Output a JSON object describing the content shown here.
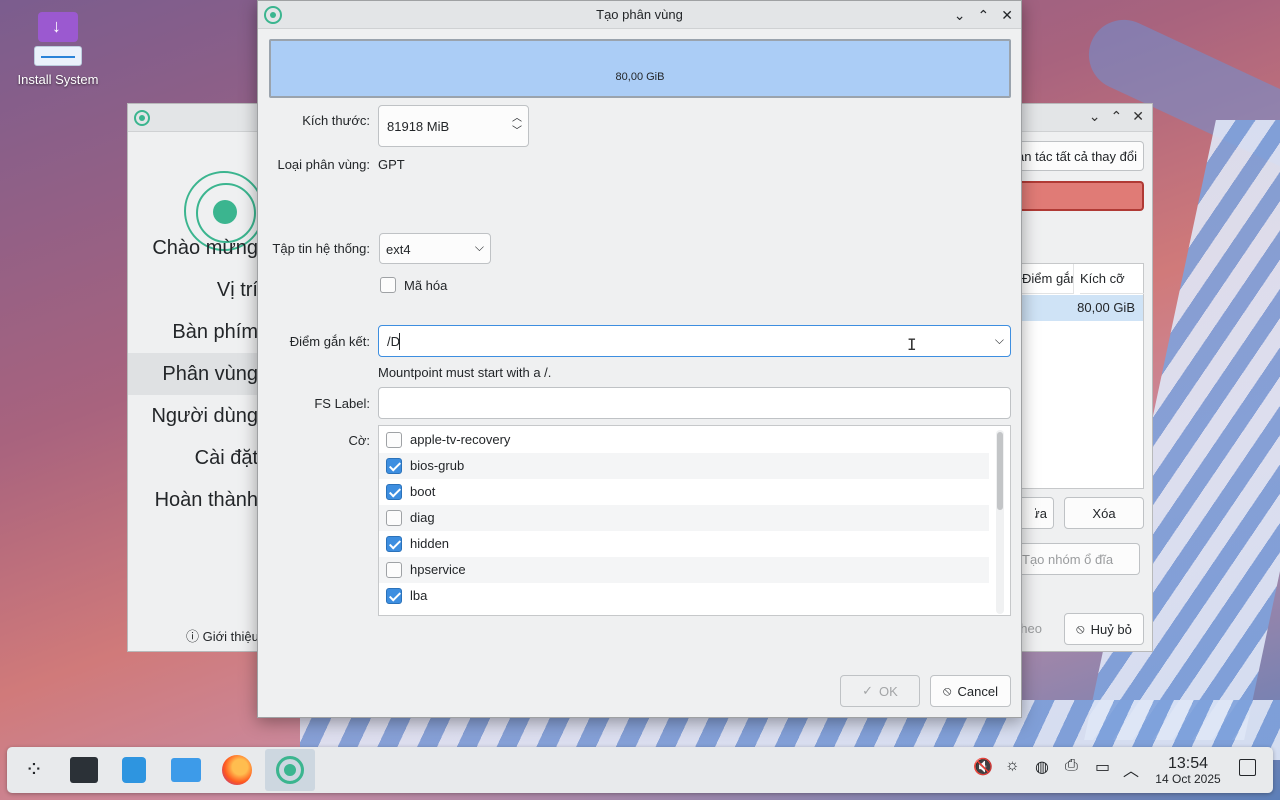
{
  "desktop": {
    "icon_label": "Install System"
  },
  "background_window": {
    "sidebar_steps": [
      "Chào mừng",
      "Vị trí",
      "Bàn phím",
      "Phân vùng",
      "Người dùng",
      "Cài đặt",
      "Hoàn thành"
    ],
    "active_step_index": 3,
    "about_label": "Giới thiệu",
    "undo_all_label": "Hoàn tác tất cả thay đổi",
    "table_headers": [
      "Điểm gắn kết",
      "Kích cỡ"
    ],
    "table_row_size": "80,00 GiB",
    "button_partial_a": "Sửa",
    "delete_label": "Xóa",
    "volume_group_label": "Tạo nhóm ổ đĩa",
    "next_partial": "Tiếp theo",
    "cancel_label": "Huỷ bỏ"
  },
  "dialog": {
    "title": "Tạo phân vùng",
    "partition_bar_label": "80,00 GiB",
    "partition_fill_fraction": 1.0,
    "size_label": "Kích thước:",
    "size_value": "81918 MiB",
    "partition_type_label": "Loại phân vùng:",
    "partition_type_value": "GPT",
    "filesystem_label": "Tập tin hệ thống:",
    "filesystem_value": "ext4",
    "encrypt_label": "Mã hóa",
    "encrypt_checked": false,
    "mountpoint_label": "Điểm gắn kết:",
    "mountpoint_value": "/D",
    "mountpoint_warning": "Mountpoint must start with a /.",
    "fs_label_label": "FS Label:",
    "fs_label_value": "",
    "flags_label": "Cờ:",
    "flags": [
      {
        "name": "apple-tv-recovery",
        "checked": false
      },
      {
        "name": "bios-grub",
        "checked": true
      },
      {
        "name": "boot",
        "checked": true
      },
      {
        "name": "diag",
        "checked": false
      },
      {
        "name": "hidden",
        "checked": true
      },
      {
        "name": "hpservice",
        "checked": false
      },
      {
        "name": "lba",
        "checked": true
      }
    ],
    "ok_label": "OK",
    "ok_enabled": false,
    "cancel_label": "Cancel"
  },
  "taskbar": {
    "apps": [
      "application-launcher-icon",
      "system-settings-icon",
      "discover-store-icon",
      "file-manager-icon",
      "firefox-icon",
      "installer-icon"
    ],
    "tray_icons": [
      "muted-speaker-icon",
      "brightness-icon",
      "network-icon",
      "input-method-icon",
      "display-icon",
      "chevron-up-icon"
    ],
    "clock_time": "13:54",
    "clock_date": "14 Oct 2025"
  },
  "colors": {
    "accent": "#3d8ee0",
    "partition_fill": "#abcdf6",
    "installer_green": "#3bb58f",
    "warning_bar": "#e07b76"
  }
}
